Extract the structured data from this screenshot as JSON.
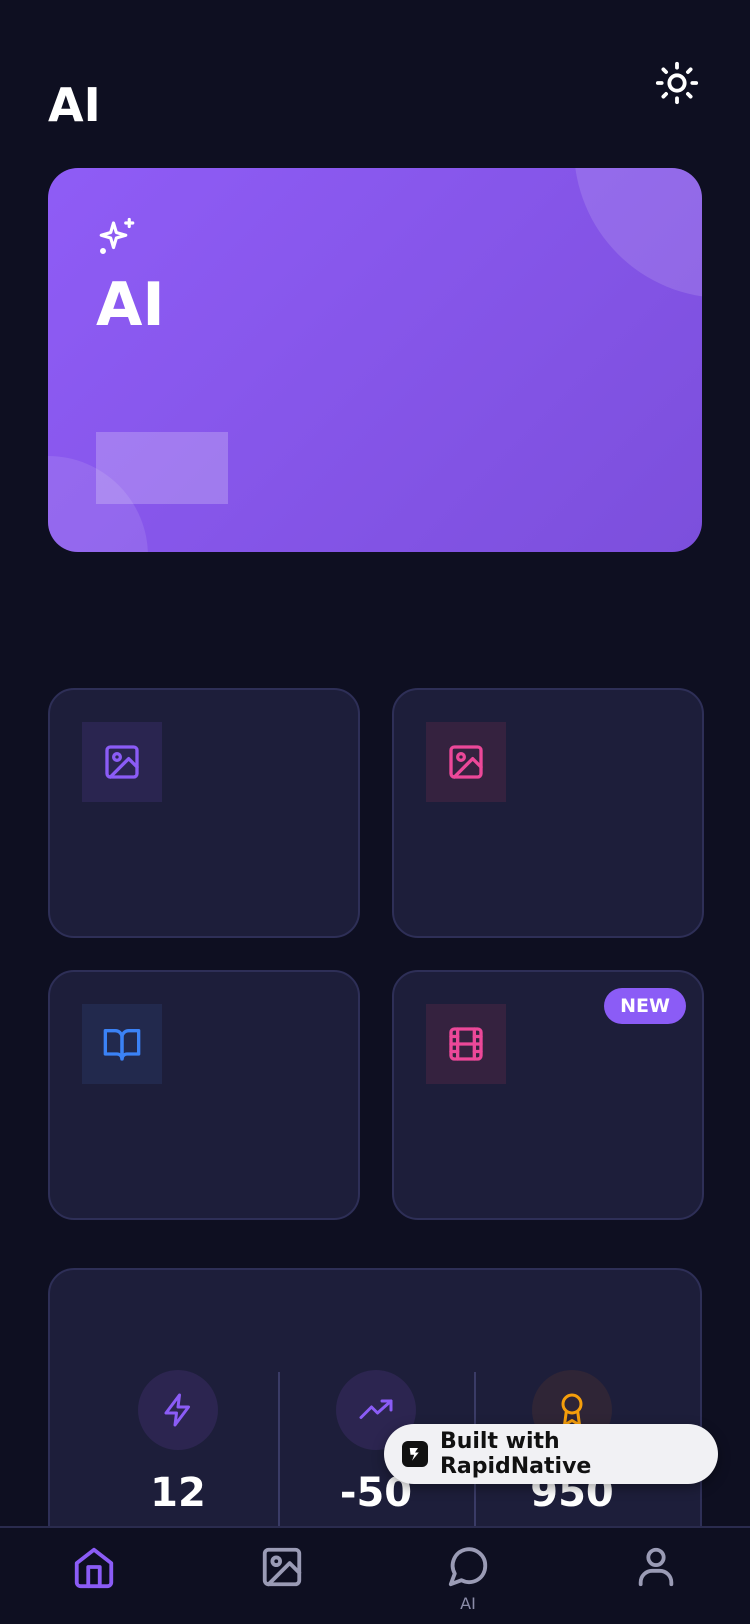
{
  "header": {
    "title": "AI",
    "theme_icon": "sun-icon"
  },
  "hero": {
    "icon": "sparkles-icon",
    "title": "AI",
    "button_label": ""
  },
  "cards": [
    {
      "icon": "image-icon",
      "icon_color": "#8b5cf6",
      "icon_bg": "#2a2550"
    },
    {
      "icon": "image-icon",
      "icon_color": "#ec4899",
      "icon_bg": "#35223f"
    },
    {
      "icon": "book-open-icon",
      "icon_color": "#3b82f6",
      "icon_bg": "#22294d"
    },
    {
      "icon": "film-icon",
      "icon_color": "#ec4899",
      "icon_bg": "#35223f",
      "badge": "NEW"
    }
  ],
  "stats": [
    {
      "icon": "zap-icon",
      "value": "12"
    },
    {
      "icon": "trending-up-icon",
      "value": "-50"
    },
    {
      "icon": "award-icon",
      "value": "950"
    }
  ],
  "toast": {
    "text": "Built with RapidNative"
  },
  "tabbar": {
    "tabs": [
      {
        "icon": "home-icon",
        "label": "",
        "active": true
      },
      {
        "icon": "image-icon",
        "label": ""
      },
      {
        "icon": "message-circle-icon",
        "label": "AI"
      },
      {
        "icon": "user-icon",
        "label": ""
      }
    ]
  },
  "colors": {
    "accent": "#8b5cf6",
    "background": "#0e0f21",
    "card": "#1d1e3a"
  }
}
